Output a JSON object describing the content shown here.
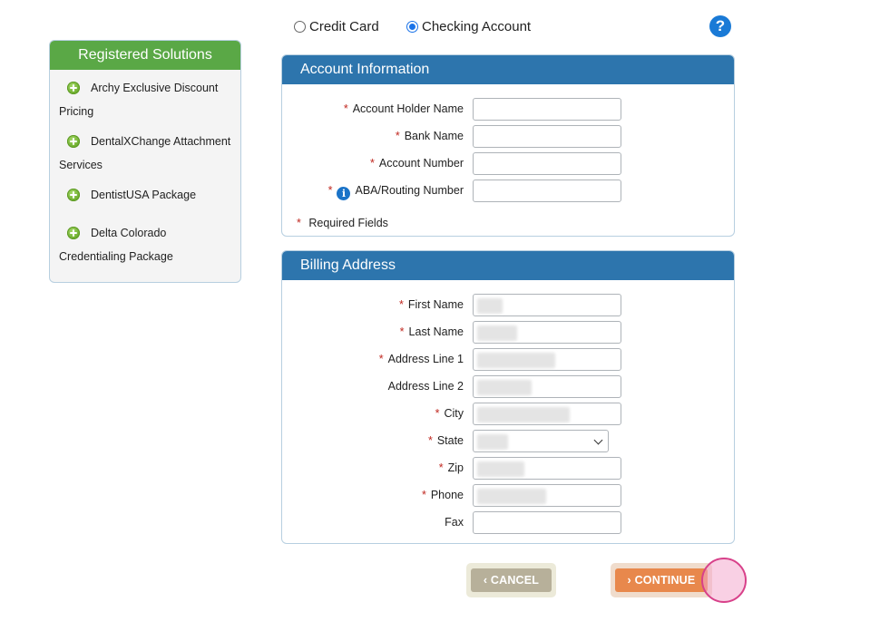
{
  "sidebar": {
    "title": "Registered Solutions",
    "items": [
      {
        "line1": "Archy Exclusive Discount",
        "line2": "Pricing"
      },
      {
        "line1": "DentalXChange Attachment",
        "line2": "Services"
      },
      {
        "line1": "DentistUSA Package",
        "line2": ""
      },
      {
        "line1": "Delta Colorado",
        "line2": "Credentialing Package"
      }
    ]
  },
  "payment": {
    "options": [
      "Credit Card",
      "Checking Account"
    ],
    "selected": "Checking Account",
    "help": "?"
  },
  "account_info": {
    "title": "Account Information",
    "fields": [
      {
        "label": "Account Holder Name",
        "required": "*",
        "value": ""
      },
      {
        "label": "Bank Name",
        "required": "*",
        "value": ""
      },
      {
        "label": "Account Number",
        "required": "*",
        "value": ""
      },
      {
        "label": "ABA/Routing Number",
        "required": "*",
        "value": "",
        "icon": "info-icon"
      }
    ],
    "required_note": "Required Fields",
    "required_mark": "*"
  },
  "billing": {
    "title": "Billing Address",
    "fields": [
      {
        "label": "First Name",
        "required": "*"
      },
      {
        "label": "Last Name",
        "required": "*"
      },
      {
        "label": "Address Line 1",
        "required": "*"
      },
      {
        "label": "Address Line 2",
        "required": ""
      },
      {
        "label": "City",
        "required": "*"
      },
      {
        "label": "State",
        "required": "*"
      },
      {
        "label": "Zip",
        "required": "*"
      },
      {
        "label": "Phone",
        "required": "*"
      },
      {
        "label": "Fax",
        "required": ""
      }
    ]
  },
  "buttons": {
    "cancel": "‹ CANCEL",
    "continue": "› CONTINUE"
  },
  "colors": {
    "sidebar_header": "#5aa846",
    "panel_header": "#2d75ad",
    "required": "#c0271f",
    "cancel": "#b7b09a",
    "continue": "#e8884c"
  }
}
